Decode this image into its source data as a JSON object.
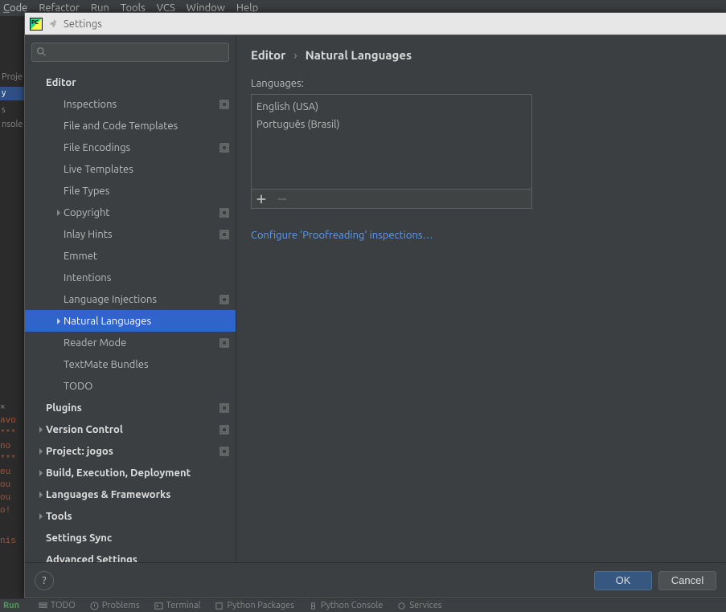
{
  "main_menu": {
    "code": "Code",
    "refactor": "Refactor",
    "run": "Run",
    "tools": "Tools",
    "vcs": "VCS",
    "window": "Window",
    "help": "Help"
  },
  "title_bar": {
    "title": "Settings"
  },
  "search": {
    "placeholder": ""
  },
  "sidebar_bg": {
    "proj": "Proje",
    "y": "y",
    "s": "s",
    "nsolo": "nsole"
  },
  "console_frag": {
    "l1": "avo",
    "l2": "***",
    "l3": "no",
    "l4": "***",
    "l5": "eu",
    "l6": "ou",
    "l7": "ou",
    "l8": "o!",
    "l9": "nis",
    "x": "×"
  },
  "tree": {
    "editor": "Editor",
    "inspections": "Inspections",
    "file_code_templates": "File and Code Templates",
    "file_encodings": "File Encodings",
    "live_templates": "Live Templates",
    "file_types": "File Types",
    "copyright": "Copyright",
    "inlay_hints": "Inlay Hints",
    "emmet": "Emmet",
    "intentions": "Intentions",
    "language_injections": "Language Injections",
    "natural_languages": "Natural Languages",
    "reader_mode": "Reader Mode",
    "textmate_bundles": "TextMate Bundles",
    "todo": "TODO",
    "plugins": "Plugins",
    "version_control": "Version Control",
    "project": "Project: jogos",
    "build": "Build, Execution, Deployment",
    "lang_fw": "Languages & Frameworks",
    "tools": "Tools",
    "settings_sync": "Settings Sync",
    "advanced": "Advanced Settings"
  },
  "breadcrumb": {
    "root": "Editor",
    "leaf": "Natural Languages"
  },
  "content": {
    "languages_label": "Languages:",
    "lang1": "English (USA)",
    "lang2": "Português (Brasil)",
    "configure_link": "Configure 'Proofreading' inspections…"
  },
  "footer": {
    "help": "?",
    "ok": "OK",
    "cancel": "Cancel"
  },
  "status_bar": {
    "run": "Run",
    "todo": "TODO",
    "problems": "Problems",
    "terminal": "Terminal",
    "py_pkg": "Python Packages",
    "py_console": "Python Console",
    "services": "Services"
  }
}
